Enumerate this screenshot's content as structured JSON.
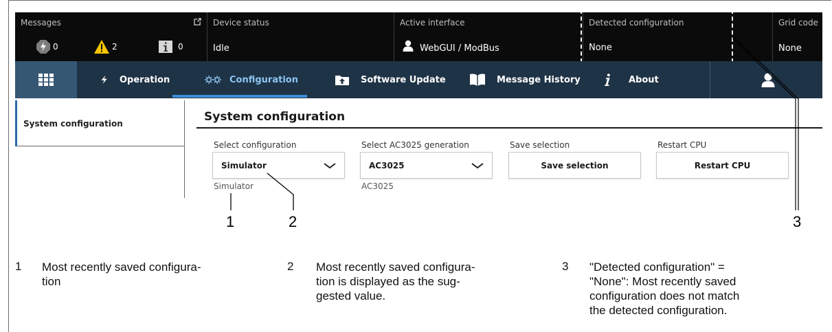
{
  "statusbar": {
    "messages": {
      "title": "Messages",
      "counts": [
        "0",
        "2",
        "0"
      ]
    },
    "device_status": {
      "title": "Device status",
      "value": "Idle"
    },
    "active_interface": {
      "title": "Active interface",
      "value": "WebGUI / ModBus"
    },
    "detected_configuration": {
      "title": "Detected configuration",
      "value": "None"
    },
    "grid_code": {
      "title": "Grid code",
      "value": "None"
    }
  },
  "nav": {
    "items": [
      {
        "label": "Operation",
        "icon": "lightning-icon"
      },
      {
        "label": "Configuration",
        "icon": "gears-icon"
      },
      {
        "label": "Software Update",
        "icon": "upload-folder-icon"
      },
      {
        "label": "Message History",
        "icon": "book-icon"
      },
      {
        "label": "About",
        "icon": "info-icon"
      }
    ],
    "active": "Configuration"
  },
  "sidebar": {
    "items": [
      {
        "label": "System configuration"
      }
    ]
  },
  "main": {
    "title": "System configuration",
    "select_configuration": {
      "label": "Select configuration",
      "value": "Simulator",
      "saved": "Simulator"
    },
    "select_generation": {
      "label": "Select AC3025 generation",
      "value": "AC3025",
      "saved": "AC3025"
    },
    "save_selection": {
      "label": "Save selection",
      "button": "Save selection"
    },
    "restart_cpu": {
      "label": "Restart CPU",
      "button": "Restart CPU"
    }
  },
  "callouts": {
    "one": "1",
    "two": "2",
    "three": "3"
  },
  "legend": [
    {
      "num": "1",
      "text": "Most recently saved configura-\ntion"
    },
    {
      "num": "2",
      "text": "Most recently saved configura-\ntion is displayed as the sug-\ngested value."
    },
    {
      "num": "3",
      "text": "\"Detected configuration\" =\n\"None\": Most recently saved\nconfiguration does not match\nthe detected configuration."
    }
  ],
  "colors": {
    "statusbar": "#0b0b0b",
    "navbar": "#1f3346",
    "nav_active": "#3b8fd9",
    "warning": "#f5c400"
  }
}
